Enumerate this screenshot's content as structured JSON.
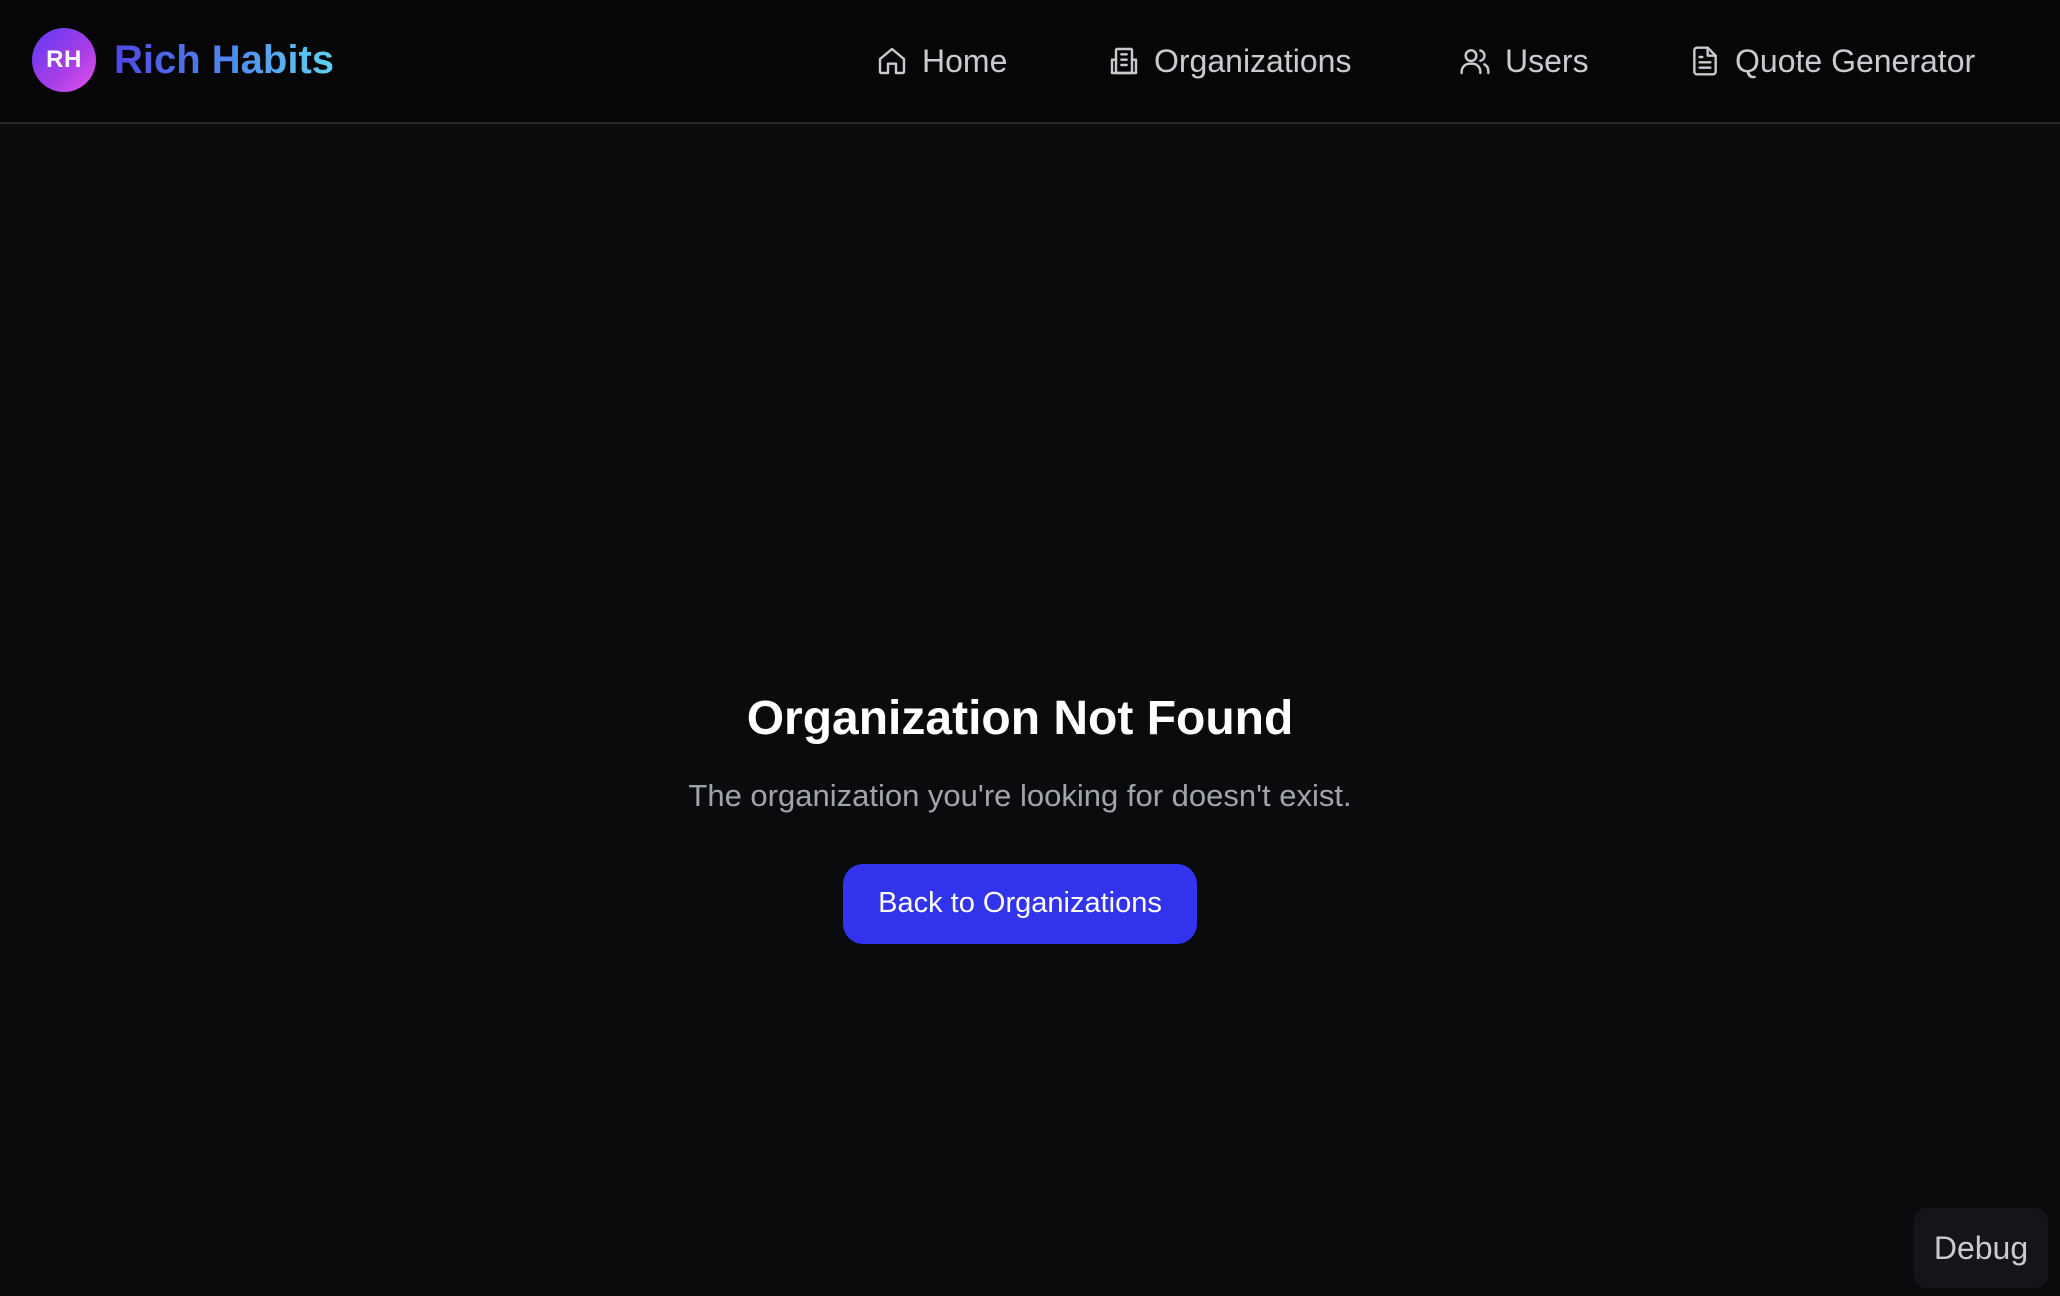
{
  "brand": {
    "avatar_initials": "RH",
    "name": "Rich Habits"
  },
  "nav": {
    "items": [
      {
        "label": "Home",
        "icon": "home-icon"
      },
      {
        "label": "Organizations",
        "icon": "building-icon"
      },
      {
        "label": "Users",
        "icon": "users-icon"
      },
      {
        "label": "Quote Generator",
        "icon": "document-icon"
      }
    ]
  },
  "main": {
    "title": "Organization Not Found",
    "message": "The organization you're looking for doesn't exist.",
    "button_label": "Back to Organizations"
  },
  "debug": {
    "label": "Debug"
  },
  "colors": {
    "background": "#0a0b0d",
    "header_background": "#060607",
    "primary_button": "#3134ec",
    "brand_gradient_start": "#4f46e5",
    "brand_gradient_end": "#5fd3f1"
  }
}
